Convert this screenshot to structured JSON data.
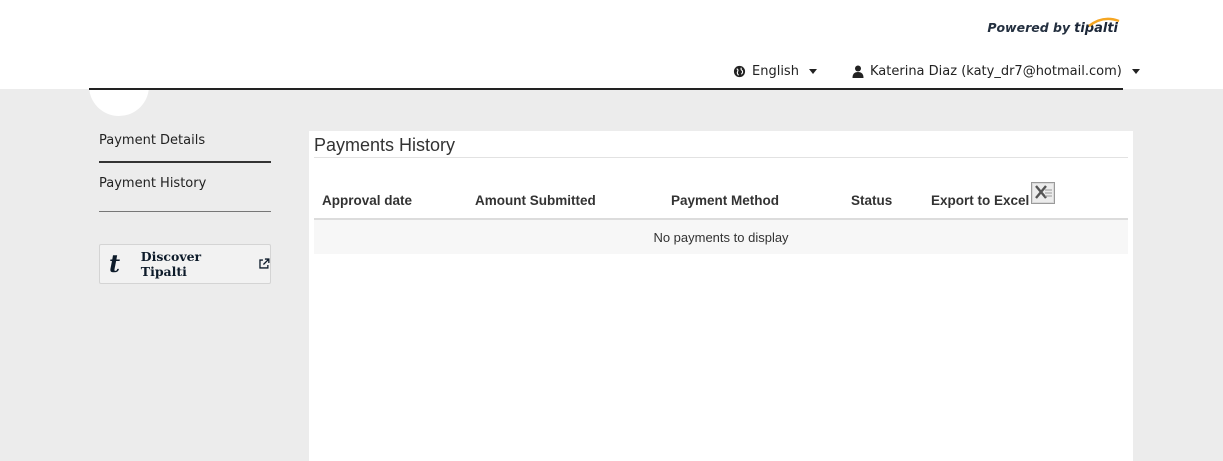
{
  "header": {
    "powered_by_label": "Powered by",
    "brand_name": "tipalti",
    "language": "English",
    "user": "Katerina Diaz (katy_dr7@hotmail.com)"
  },
  "sidebar": {
    "items": [
      {
        "label": "Payment Details"
      },
      {
        "label": "Payment History"
      }
    ],
    "discover_label": "Discover Tipalti",
    "discover_logo": "t"
  },
  "main": {
    "title": "Payments History",
    "columns": [
      "Approval date",
      "Amount Submitted",
      "Payment Method",
      "Status",
      "Export to Excel"
    ],
    "empty_message": "No payments to display"
  },
  "colors": {
    "brand_accent": "#f5a623",
    "brand_dark": "#1c2738",
    "page_bg": "#ececec"
  },
  "icons": [
    "globe-icon",
    "user-icon",
    "caret-down-icon",
    "external-link-icon",
    "excel-icon"
  ]
}
